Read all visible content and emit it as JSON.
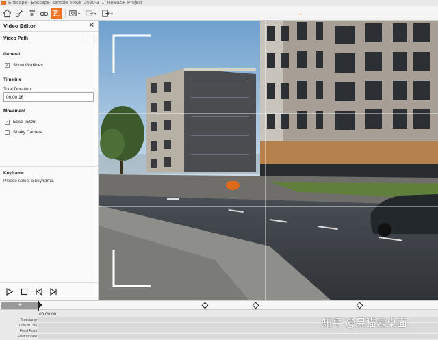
{
  "window": {
    "title": "Enscape - Enscape_sample_Revit_2020-3_1_Release_Project"
  },
  "toolbar": {
    "items": [
      {
        "name": "home",
        "label": ""
      },
      {
        "name": "nodes",
        "label": ""
      },
      {
        "name": "bim",
        "label": "BIM"
      },
      {
        "name": "vr",
        "label": ""
      },
      {
        "name": "video-editor",
        "label": "",
        "active": true
      },
      {
        "name": "capture",
        "label": ""
      },
      {
        "name": "export",
        "label": ""
      },
      {
        "name": "send",
        "label": ""
      }
    ]
  },
  "panel": {
    "title": "Video Editor",
    "video_path_label": "Video Path",
    "general_heading": "General",
    "show_gridlines": {
      "label": "Show Gridlines",
      "checked": true
    },
    "timeline_heading": "Timeline",
    "total_duration_label": "Total Duration",
    "total_duration_value": "00:00:16",
    "movement_heading": "Movement",
    "ease_in_out": {
      "label": "Ease In/Out",
      "checked": true
    },
    "shaky_camera": {
      "label": "Shaky Camera",
      "checked": false
    },
    "keyframe_heading": "Keyframe",
    "keyframe_message": "Please select a keyframe."
  },
  "timeline": {
    "add_label": "+",
    "current_time": "00:00:00",
    "keyframes": 3,
    "rows": [
      "Timestamp",
      "Time of Day",
      "Focal Point",
      "Field of View"
    ]
  },
  "watermark": "知乎 @呆猫云桌面",
  "colors": {
    "accent": "#f07422",
    "sky": "#8fb8da",
    "road": "#3c4146"
  }
}
